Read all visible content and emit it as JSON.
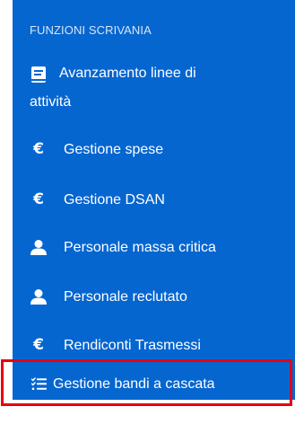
{
  "sidebar": {
    "section_title": "FUNZIONI SCRIVANIA",
    "items": [
      {
        "label_line1": "Avanzamento linee di",
        "label_line2": "attività",
        "icon": "book-icon"
      },
      {
        "label": "Gestione spese",
        "icon": "euro-icon"
      },
      {
        "label": "Gestione DSAN",
        "icon": "euro-icon"
      },
      {
        "label": "Personale massa critica",
        "icon": "user-icon"
      },
      {
        "label": "Personale reclutato",
        "icon": "user-icon"
      },
      {
        "label": "Rendiconti Trasmessi",
        "icon": "euro-icon"
      },
      {
        "label": "Gestione bandi a cascata",
        "icon": "checklist-icon"
      }
    ],
    "euro_glyph": "€"
  },
  "colors": {
    "sidebar_background": "#0666d0",
    "text": "#ffffff",
    "highlight_border": "#e60012"
  }
}
